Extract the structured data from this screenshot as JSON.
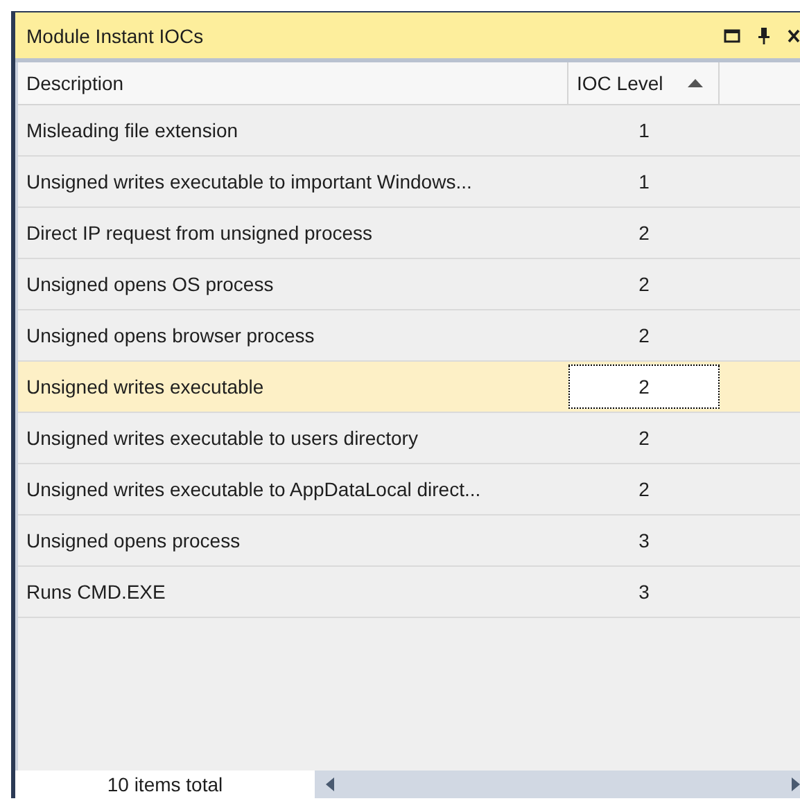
{
  "panel": {
    "title": "Module Instant IOCs"
  },
  "table": {
    "columns": [
      {
        "label": "Description",
        "sorted": false
      },
      {
        "label": "IOC Level",
        "sorted": true
      }
    ],
    "rows": [
      {
        "description": "Misleading file extension",
        "ioc_level": "1",
        "selected": false
      },
      {
        "description": "Unsigned writes executable to important Windows...",
        "ioc_level": "1",
        "selected": false
      },
      {
        "description": "Direct IP request from unsigned process",
        "ioc_level": "2",
        "selected": false
      },
      {
        "description": "Unsigned opens OS process",
        "ioc_level": "2",
        "selected": false
      },
      {
        "description": "Unsigned opens browser process",
        "ioc_level": "2",
        "selected": false
      },
      {
        "description": "Unsigned writes executable",
        "ioc_level": "2",
        "selected": true
      },
      {
        "description": "Unsigned writes executable to users directory",
        "ioc_level": "2",
        "selected": false
      },
      {
        "description": "Unsigned writes executable to AppDataLocal direct...",
        "ioc_level": "2",
        "selected": false
      },
      {
        "description": "Unsigned opens process",
        "ioc_level": "3",
        "selected": false
      },
      {
        "description": "Runs CMD.EXE",
        "ioc_level": "3",
        "selected": false
      }
    ]
  },
  "status_bar": {
    "total": "10 items total"
  }
}
